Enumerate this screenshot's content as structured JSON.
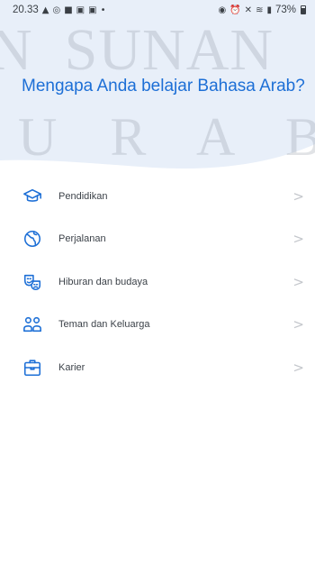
{
  "status_bar": {
    "time": "20.33",
    "left_icons": [
      "warning-icon",
      "instagram-icon",
      "facebook-icon",
      "youtube-icon",
      "youtube-icon",
      "dot-icon"
    ],
    "right_icons": [
      "privacy-icon",
      "alarm-icon",
      "mute-icon",
      "wifi-icon",
      "signal-icon"
    ],
    "battery": "73%"
  },
  "watermark": {
    "line1": "N  SUNAN",
    "line2": "U R A B"
  },
  "title": "Mengapa Anda belajar Bahasa Arab?",
  "options": [
    {
      "label": "Pendidikan",
      "icon": "graduation-cap-icon"
    },
    {
      "label": "Perjalanan",
      "icon": "globe-icon"
    },
    {
      "label": "Hiburan dan budaya",
      "icon": "theater-masks-icon"
    },
    {
      "label": "Teman dan Keluarga",
      "icon": "people-icon"
    },
    {
      "label": "Karier",
      "icon": "briefcase-icon"
    }
  ],
  "chevron": ">",
  "colors": {
    "accent": "#1d6fd6",
    "header_bg": "#e6eef9",
    "text": "#3c4249",
    "chevron": "#c4c7cc"
  }
}
